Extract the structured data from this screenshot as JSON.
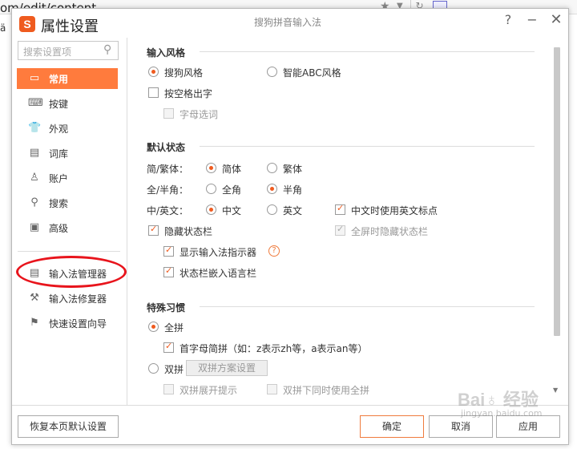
{
  "browser": {
    "url_fragment": "om/edit/content",
    "left_char": "ä"
  },
  "dialog": {
    "logo": "S",
    "title": "属性设置",
    "subtitle": "搜狗拼音输入法",
    "help": "?",
    "minimize": "−",
    "close": "✕"
  },
  "sidebar": {
    "search_placeholder": "搜索设置项",
    "items": [
      {
        "label": "常用",
        "icon": "monitor-icon",
        "active": true
      },
      {
        "label": "按键",
        "icon": "keyboard-icon"
      },
      {
        "label": "外观",
        "icon": "shirt-icon"
      },
      {
        "label": "词库",
        "icon": "book-icon"
      },
      {
        "label": "账户",
        "icon": "user-icon"
      },
      {
        "label": "搜索",
        "icon": "search-icon"
      },
      {
        "label": "高级",
        "icon": "advanced-icon"
      }
    ],
    "tools": [
      {
        "label": "输入法管理器",
        "icon": "manager-icon"
      },
      {
        "label": "输入法修复器",
        "icon": "repair-icon"
      },
      {
        "label": "快速设置向导",
        "icon": "flag-icon"
      }
    ]
  },
  "input_style": {
    "title": "输入风格",
    "sogou_style": "搜狗风格",
    "abc_style": "智能ABC风格",
    "space_output": "按空格出字",
    "letter_select": "字母选词"
  },
  "default_state": {
    "title": "默认状态",
    "simp_trad_label": "简/繁体：",
    "simplified": "简体",
    "traditional": "繁体",
    "width_label": "全/半角：",
    "full_width": "全角",
    "half_width": "半角",
    "zh_en_label": "中/英文：",
    "chinese": "中文",
    "english": "英文",
    "en_punct": "中文时使用英文标点",
    "hide_status": "隐藏状态栏",
    "fullscreen_hide": "全屏时隐藏状态栏",
    "show_indicator": "显示输入法指示器",
    "embed_langbar": "状态栏嵌入语言栏"
  },
  "special_habits": {
    "title": "特殊习惯",
    "full_pinyin": "全拼",
    "initial_abbrev": "首字母简拼（如：z表示zh等，a表示an等）",
    "double_pinyin": "双拼",
    "scheme_button": "双拼方案设置",
    "double_expand": "双拼展开提示",
    "double_with_full": "双拼下同时使用全拼"
  },
  "footer": {
    "restore": "恢复本页默认设置",
    "ok": "确定",
    "cancel": "取消",
    "apply": "应用"
  },
  "watermark": {
    "main": "Bai♁ 经验",
    "sub": "jingyan.baidu.com"
  },
  "colors": {
    "accent": "#ff7b3d",
    "highlight_circle": "#e8141c"
  }
}
